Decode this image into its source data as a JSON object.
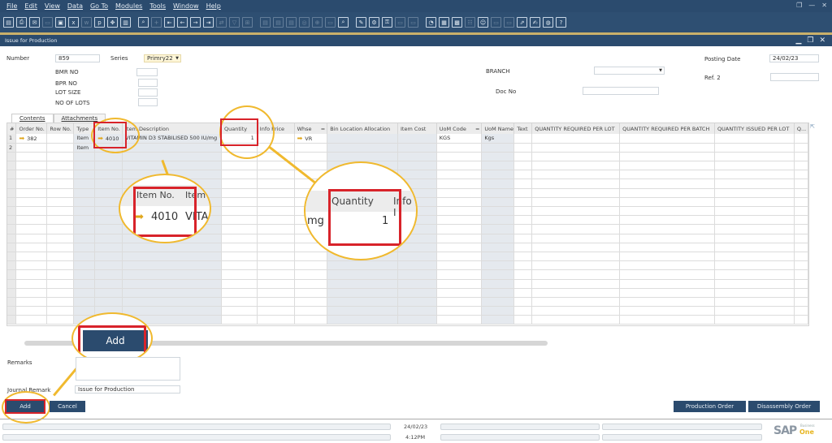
{
  "menu": [
    "File",
    "Edit",
    "View",
    "Data",
    "Go To",
    "Modules",
    "Tools",
    "Window",
    "Help"
  ],
  "window_controls": {
    "restore": "❐",
    "minimize": "—",
    "close": "✕"
  },
  "form": {
    "title": "Issue for Production",
    "number_label": "Number",
    "number_value": "859",
    "series_label": "Series",
    "series_value": "Primry22",
    "bmr_label": "BMR NO",
    "bpr_label": "BPR NO",
    "lot_size_label": "LOT SIZE",
    "no_of_lots_label": "NO OF LOTS",
    "branch_label": "BRANCH",
    "branch_value": "",
    "doc_no_label": "Doc No",
    "doc_no_value": "",
    "posting_date_label": "Posting Date",
    "posting_date_value": "24/02/23",
    "ref2_label": "Ref. 2",
    "ref2_value": ""
  },
  "tabs": [
    "Contents",
    "Attachments"
  ],
  "table": {
    "columns": [
      "#",
      "Order No.",
      "Row No.",
      "Type",
      "Item No.",
      "Item Description",
      "Quantity",
      "Info Price",
      "Whse",
      "Bin Location Allocation",
      "Item Cost",
      "UoM Code",
      "UoM Name",
      "Text",
      "QUANTITY REQUIRED PER LOT",
      "QUANTITY REQUIRED PER BATCH",
      "QUANTITY ISSUED PER LOT",
      "Q..."
    ],
    "rows": [
      {
        "idx": "1",
        "order_no": "382",
        "row_no": "",
        "type": "Item",
        "item_no": "4010",
        "description": "VITAMIN D3 STABILISED 500 IU/mg",
        "quantity": "1",
        "info_price": "",
        "whse": "VR",
        "bin": "",
        "item_cost": "",
        "uom_code": "KGS",
        "uom_name": "Kgs",
        "text": "",
        "qrpl": "",
        "qrpb": "",
        "qipl": "",
        "q": ""
      },
      {
        "idx": "2",
        "order_no": "",
        "row_no": "",
        "type": "Item",
        "item_no": "",
        "description": "",
        "quantity": "",
        "info_price": "",
        "whse": "",
        "bin": "",
        "item_cost": "",
        "uom_code": "",
        "uom_name": "",
        "text": "",
        "qrpl": "",
        "qrpb": "",
        "qipl": "",
        "q": ""
      }
    ]
  },
  "callouts": {
    "item_no_header": "Item No.",
    "item_next_header": "Item",
    "item_no_value": "4010",
    "item_desc_partial": "VITAN",
    "quantity_header": "Quantity",
    "info_partial": "Info I",
    "uom_partial": "mg",
    "quantity_value": "1",
    "add_label": "Add"
  },
  "footer": {
    "remarks_label": "Remarks",
    "remarks_value": "",
    "journal_remark_label": "Journal Remark",
    "journal_remark_value": "Issue for Production",
    "add_button": "Add",
    "cancel_button": "Cancel",
    "production_order_button": "Production Order",
    "disassembly_order_button": "Disassembly Order"
  },
  "status": {
    "date": "24/02/23",
    "time": "4:12PM",
    "brand_sap": "SAP",
    "brand_one": "One",
    "brand_business": "Business"
  }
}
